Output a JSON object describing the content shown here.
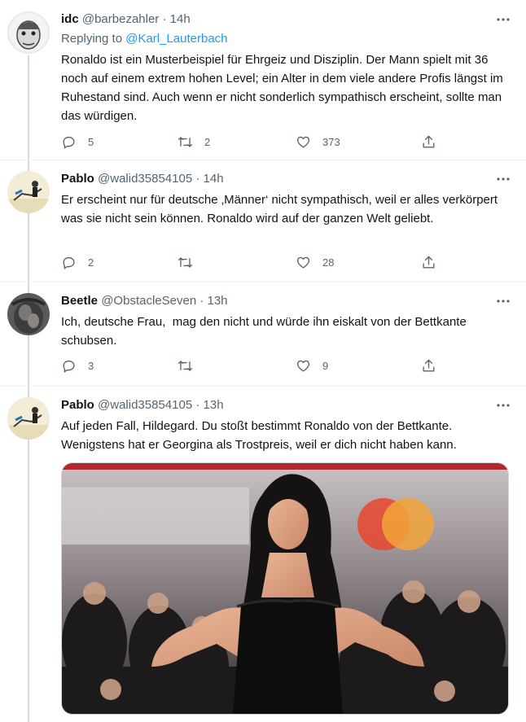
{
  "tweets": [
    {
      "name": "idc",
      "handle": "@barbezahler",
      "time": "14h",
      "reply_label": "Replying to",
      "reply_to": "@Karl_Lauterbach",
      "text": "Ronaldo ist ein Musterbeispiel für Ehrgeiz und Disziplin. Der Mann spielt mit 36 noch auf einem extrem hohen Level; ein Alter in dem viele andere Profis längst im Ruhestand sind. Auch wenn er nicht sonderlich sympathisch erscheint, sollte man das würdigen.",
      "replies": "5",
      "retweets": "2",
      "likes": "373"
    },
    {
      "name": "Pablo",
      "handle": "@walid35854105",
      "time": "14h",
      "text": "Er erscheint nur für deutsche ‚Männer‘ nicht sympathisch, weil er alles verkörpert was sie nicht sein können. Ronaldo wird auf der ganzen Welt geliebt.",
      "replies": "2",
      "retweets": "",
      "likes": "28"
    },
    {
      "name": "Beetle",
      "handle": "@ObstacleSeven",
      "time": "13h",
      "text": "Ich, deutsche Frau,  mag den nicht und würde ihn eiskalt von der Bettkante schubsen.",
      "replies": "3",
      "retweets": "",
      "likes": "9"
    },
    {
      "name": "Pablo",
      "handle": "@walid35854105",
      "time": "13h",
      "text": "Auf jeden Fall, Hildegard. Du stoßt bestimmt Ronaldo von der Bettkante. Wenigstens hat er Georgina als Trostpreis, weil er dich nicht haben kann."
    }
  ],
  "separator": "·",
  "icons": {
    "reply": "reply-icon",
    "retweet": "retweet-icon",
    "like": "heart-icon",
    "share": "share-icon",
    "more": "more-icon"
  },
  "colors": {
    "link": "#1d9bf0",
    "secondary_text": "#536471",
    "thread_line": "#cfd9de",
    "divider": "#eff3f4"
  }
}
